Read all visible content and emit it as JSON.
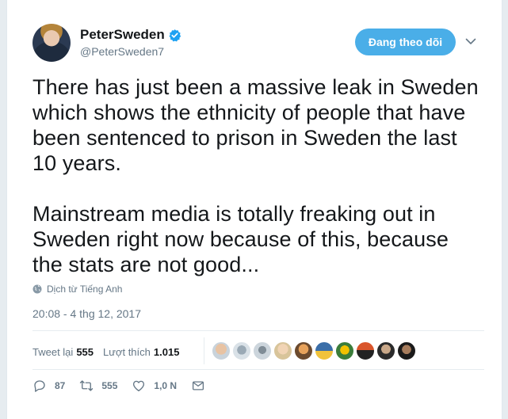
{
  "author": {
    "display_name": "PeterSweden",
    "handle": "@PeterSweden7"
  },
  "follow_button_label": "Đang theo dõi",
  "tweet": {
    "paragraphs": [
      "There has just been a massive leak in Sweden which shows the ethnicity of people that have been sentenced to prison in Sweden the last 10 years.",
      "Mainstream media is totally freaking out in Sweden right now because of this, because the stats are not good..."
    ],
    "translate_label": "Dịch từ Tiếng Anh",
    "timestamp": "20:08 - 4 thg 12, 2017"
  },
  "stats": {
    "retweets_label": "Tweet lại",
    "retweets_count": "555",
    "likes_label": "Lượt thích",
    "likes_count": "1.015"
  },
  "actions": {
    "replies": "87",
    "retweets": "555",
    "likes": "1,0 N"
  },
  "colors": {
    "accent": "#4aaee8",
    "muted": "#657786",
    "text": "#14171a"
  },
  "icons": [
    "verified-icon",
    "caret-down-icon",
    "globe-icon",
    "reply-icon",
    "retweet-icon",
    "like-icon",
    "message-icon"
  ]
}
